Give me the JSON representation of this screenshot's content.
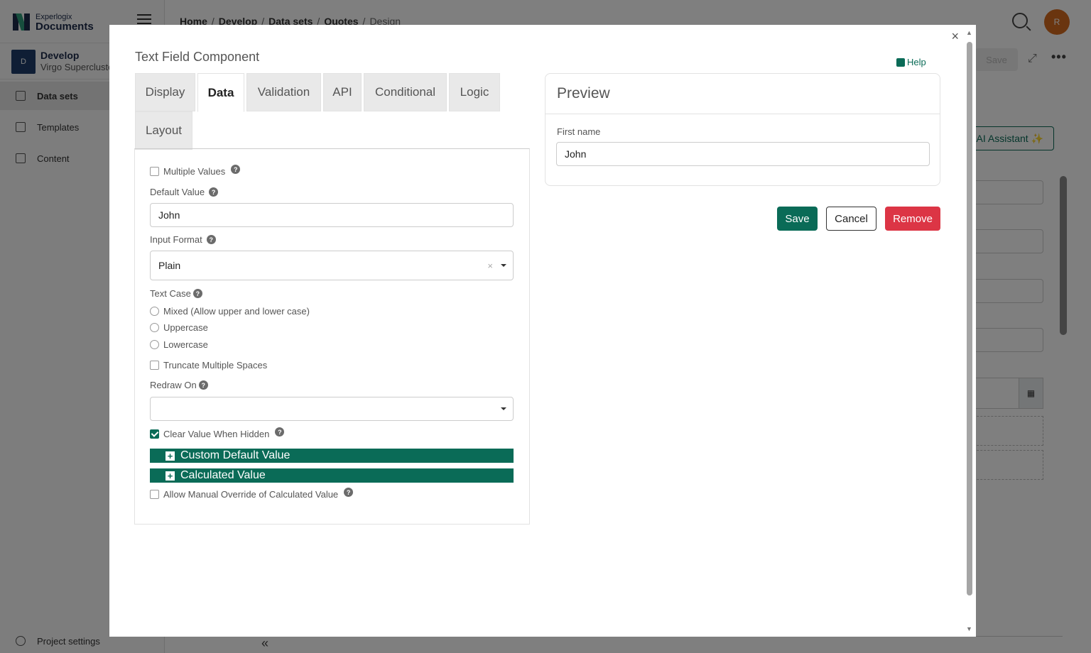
{
  "app": {
    "logo_small": "Experlogix",
    "logo_big": "Documents",
    "workspace": {
      "avatar": "D",
      "title": "Develop",
      "subtitle": "Virgo Supercluster"
    },
    "nav": [
      {
        "label": "Data sets",
        "active": true,
        "icon": "database-icon"
      },
      {
        "label": "Templates",
        "active": false,
        "icon": "template-icon"
      },
      {
        "label": "Content",
        "active": false,
        "icon": "content-icon"
      }
    ],
    "project_settings": "Project settings",
    "collapse_glyph": "«",
    "breadcrumb": [
      "Home",
      "Develop",
      "Data sets",
      "Quotes",
      "Design"
    ],
    "user_initial": "R",
    "save_label": "Save",
    "ai_assistant": "AI Assistant ✨"
  },
  "modal": {
    "title": "Text Field Component",
    "help": "Help",
    "close_glyph": "×",
    "tabs": [
      "Display",
      "Data",
      "Validation",
      "API",
      "Conditional",
      "Logic",
      "Layout"
    ],
    "active_tab": "Data",
    "fields": {
      "multiple_values": {
        "label": "Multiple Values",
        "checked": false
      },
      "default_value": {
        "label": "Default Value",
        "value": "John"
      },
      "input_format": {
        "label": "Input Format",
        "value": "Plain",
        "clear": "×"
      },
      "text_case": {
        "label": "Text Case",
        "options": [
          "Mixed (Allow upper and lower case)",
          "Uppercase",
          "Lowercase"
        ]
      },
      "truncate_spaces": {
        "label": "Truncate Multiple Spaces",
        "checked": false
      },
      "redraw_on": {
        "label": "Redraw On",
        "value": ""
      },
      "clear_when_hidden": {
        "label": "Clear Value When Hidden",
        "checked": true
      },
      "custom_default": {
        "label": "Custom Default Value"
      },
      "calculated_value": {
        "label": "Calculated Value"
      },
      "allow_override": {
        "label": "Allow Manual Override of Calculated Value",
        "checked": false
      }
    },
    "help_glyph": "?",
    "plus_glyph": "+",
    "preview": {
      "title": "Preview",
      "field_label": "First name",
      "field_value": "John"
    },
    "buttons": {
      "save": "Save",
      "cancel": "Cancel",
      "remove": "Remove"
    }
  },
  "colors": {
    "brand_green": "#0a6b57",
    "danger": "#dc3545",
    "avatar_orange": "#d46a1f"
  }
}
